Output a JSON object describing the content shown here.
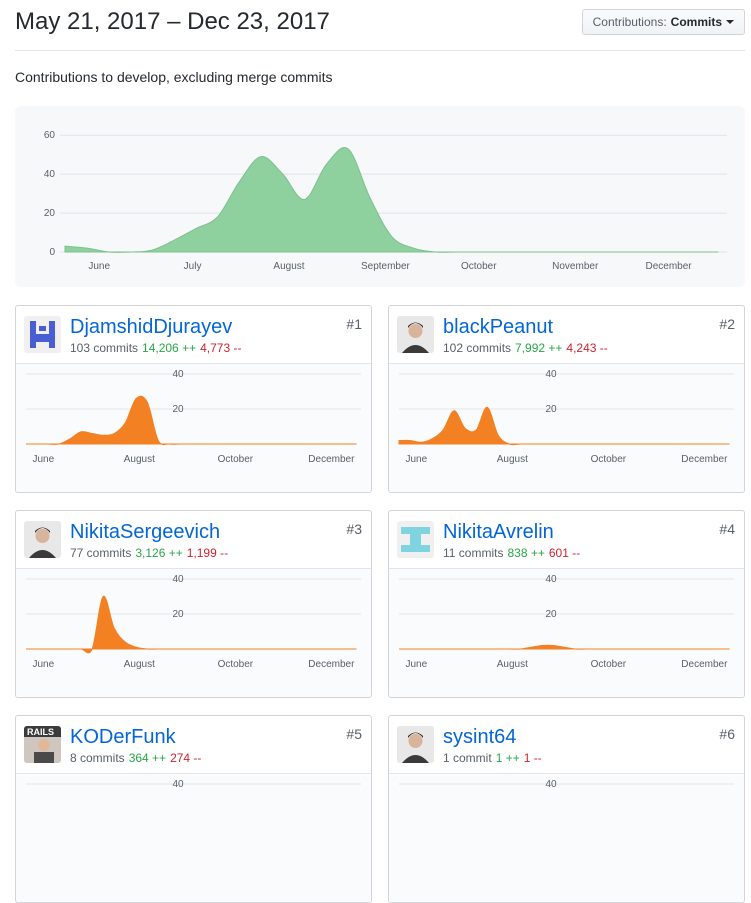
{
  "header": {
    "title": "May 21, 2017 – Dec 23, 2017",
    "select_label": "Contributions:",
    "select_value": "Commits"
  },
  "subtitle": "Contributions to develop, excluding merge commits",
  "colors": {
    "main_area": "#8fd19e",
    "main_stroke": "#7fc08f",
    "card_area": "#f48024",
    "link": "#0366d6",
    "add": "#28a745",
    "del": "#cb2431"
  },
  "chart_data": [
    {
      "type": "area",
      "title": "",
      "x_ticks": [
        "June",
        "July",
        "August",
        "September",
        "October",
        "November",
        "December"
      ],
      "y_ticks": [
        0,
        20,
        40,
        60
      ],
      "ylim": [
        0,
        65
      ],
      "x": [
        "May 21",
        "May 28",
        "Jun 4",
        "Jun 11",
        "Jun 18",
        "Jun 25",
        "Jul 2",
        "Jul 9",
        "Jul 16",
        "Jul 23",
        "Jul 30",
        "Aug 6",
        "Aug 13",
        "Aug 20",
        "Aug 27",
        "Sep 3",
        "Sep 10",
        "Sep 17",
        "Sep 24",
        "Oct 1",
        "Oct 8",
        "Oct 15",
        "Oct 22",
        "Oct 29",
        "Nov 5",
        "Nov 12",
        "Nov 19",
        "Nov 26",
        "Dec 3",
        "Dec 10",
        "Dec 17"
      ],
      "series": [
        {
          "values": [
            3,
            2,
            0,
            0,
            1,
            6,
            12,
            18,
            36,
            49,
            40,
            27,
            45,
            53,
            28,
            8,
            2,
            0,
            0,
            0,
            0,
            0,
            0,
            0,
            0,
            0,
            0,
            0,
            0,
            0,
            0
          ]
        }
      ]
    },
    {
      "type": "area",
      "user": "DjamshidDjurayev",
      "x_ticks": [
        "June",
        "August",
        "October",
        "December"
      ],
      "y_ticks": [
        20,
        40
      ],
      "ylim": [
        0,
        40
      ],
      "series": [
        {
          "values": [
            0,
            0,
            0,
            0,
            3,
            7,
            6,
            5,
            6,
            12,
            26,
            24,
            2,
            0,
            0,
            0,
            0,
            0,
            0,
            0,
            0,
            0,
            0,
            0,
            0,
            0,
            0,
            0,
            0,
            0,
            0
          ]
        }
      ]
    },
    {
      "type": "area",
      "user": "blackPeanut",
      "x_ticks": [
        "June",
        "August",
        "October",
        "December"
      ],
      "y_ticks": [
        20,
        40
      ],
      "ylim": [
        0,
        40
      ],
      "series": [
        {
          "values": [
            2,
            2,
            1,
            3,
            8,
            19,
            9,
            8,
            21,
            5,
            0,
            0,
            0,
            0,
            0,
            0,
            0,
            0,
            0,
            0,
            0,
            0,
            0,
            0,
            0,
            0,
            0,
            0,
            0,
            0,
            0
          ]
        }
      ]
    },
    {
      "type": "area",
      "user": "NikitaSergeevich",
      "x_ticks": [
        "June",
        "August",
        "October",
        "December"
      ],
      "y_ticks": [
        20,
        40
      ],
      "ylim": [
        0,
        40
      ],
      "series": [
        {
          "values": [
            0,
            0,
            0,
            0,
            0,
            0,
            0,
            30,
            12,
            4,
            1,
            0,
            0,
            0,
            0,
            0,
            0,
            0,
            0,
            0,
            0,
            0,
            0,
            0,
            0,
            0,
            0,
            0,
            0,
            0,
            0
          ]
        }
      ]
    },
    {
      "type": "area",
      "user": "NikitaAvrelin",
      "x_ticks": [
        "June",
        "August",
        "October",
        "December"
      ],
      "y_ticks": [
        20,
        40
      ],
      "ylim": [
        0,
        40
      ],
      "series": [
        {
          "values": [
            0,
            0,
            0,
            0,
            0,
            0,
            0,
            0,
            0,
            0,
            0,
            0,
            1,
            2,
            2,
            1,
            0,
            0,
            0,
            0,
            0,
            0,
            0,
            0,
            0,
            0,
            0,
            0,
            0,
            0,
            0
          ]
        }
      ]
    },
    {
      "type": "area",
      "user": "KODerFunk",
      "x_ticks": [],
      "y_ticks": [
        40
      ],
      "ylim": [
        0,
        40
      ],
      "series": [
        {
          "values": []
        }
      ]
    },
    {
      "type": "area",
      "user": "sysint64",
      "x_ticks": [],
      "y_ticks": [
        40
      ],
      "ylim": [
        0,
        40
      ],
      "series": [
        {
          "values": []
        }
      ]
    }
  ],
  "contributors": [
    {
      "login": "DjamshidDjurayev",
      "commits": "103 commits",
      "additions": "14,206 ++",
      "deletions": "4,773 --",
      "rank": "#1",
      "avatar": "identicon-blue-icon"
    },
    {
      "login": "blackPeanut",
      "commits": "102 commits",
      "additions": "7,992 ++",
      "deletions": "4,243 --",
      "rank": "#2",
      "avatar": "photo-portrait-icon"
    },
    {
      "login": "NikitaSergeevich",
      "commits": "77 commits",
      "additions": "3,126 ++",
      "deletions": "1,199 --",
      "rank": "#3",
      "avatar": "photo-portrait-icon"
    },
    {
      "login": "NikitaAvrelin",
      "commits": "11 commits",
      "additions": "838 ++",
      "deletions": "601 --",
      "rank": "#4",
      "avatar": "identicon-teal-icon"
    },
    {
      "login": "KODerFunk",
      "commits": "8 commits",
      "additions": "364 ++",
      "deletions": "274 --",
      "rank": "#5",
      "avatar": "rails-photo-icon"
    },
    {
      "login": "sysint64",
      "commits": "1 commit",
      "additions": "1 ++",
      "deletions": "1 --",
      "rank": "#6",
      "avatar": "photo-portrait-icon"
    }
  ]
}
